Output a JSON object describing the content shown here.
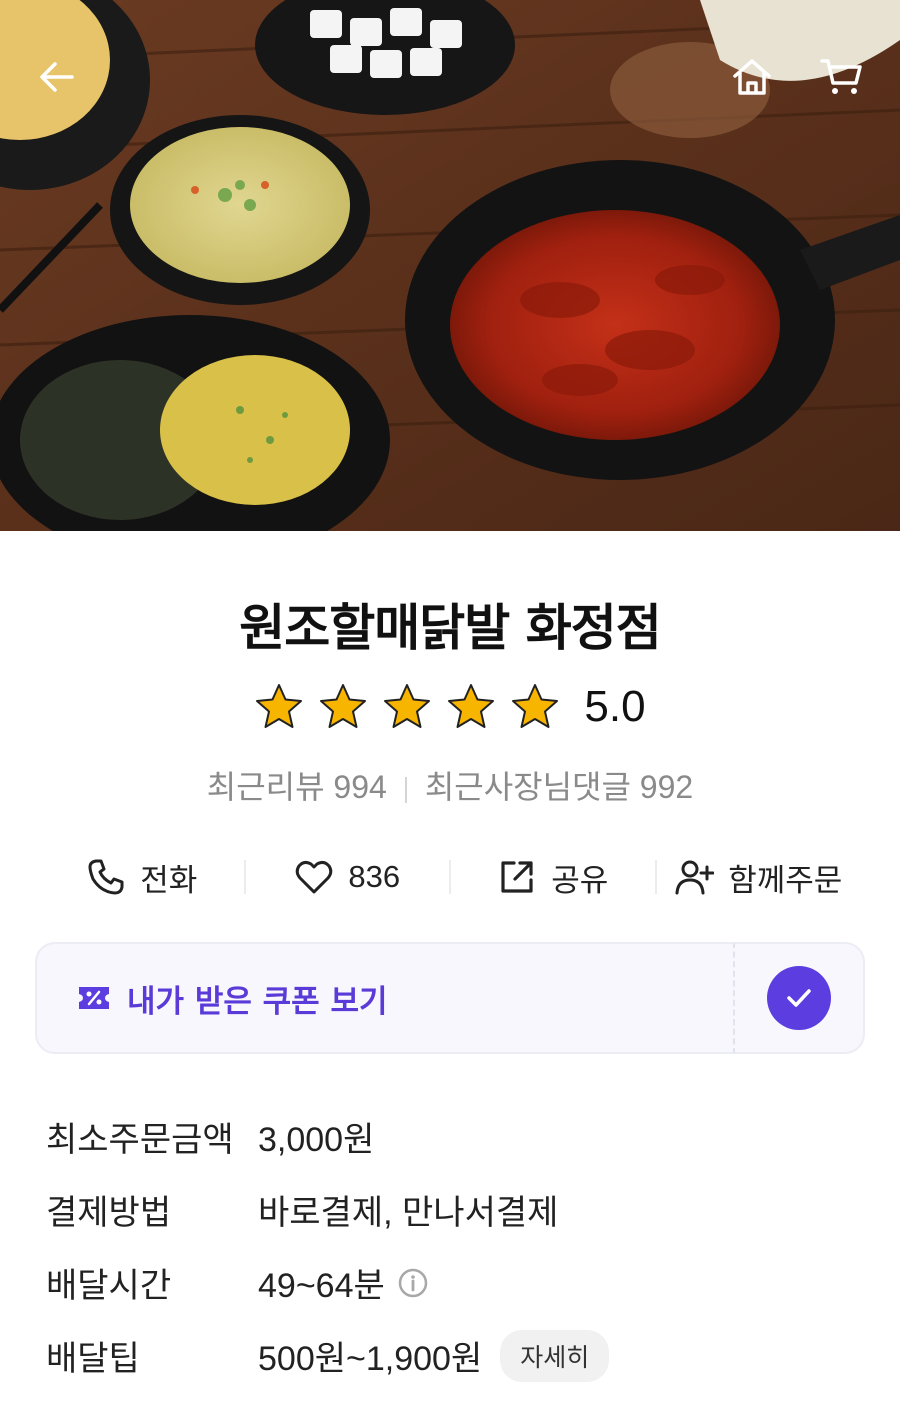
{
  "header": {
    "back_icon": "arrow-left-icon",
    "home_icon": "home-icon",
    "cart_icon": "cart-icon"
  },
  "store": {
    "name": "원조할매닭발 화정점",
    "rating": "5.0",
    "stars": 5,
    "recent_reviews": "최근리뷰 994",
    "owner_replies": "최근사장님댓글 992"
  },
  "actions": {
    "call": "전화",
    "likes": "836",
    "share": "공유",
    "group_order": "함께주문"
  },
  "coupon": {
    "label": "내가 받은 쿠폰 보기"
  },
  "info": {
    "min_order_label": "최소주문금액",
    "min_order_value": "3,000원",
    "payment_label": "결제방법",
    "payment_value": "바로결제, 만나서결제",
    "delivery_time_label": "배달시간",
    "delivery_time_value": "49~64분",
    "delivery_tip_label": "배달팁",
    "delivery_tip_value": "500원~1,900원",
    "detail_button": "자세히"
  },
  "colors": {
    "accent": "#5c3ee0",
    "star": "#f7b500",
    "muted": "#8a8a8a"
  }
}
